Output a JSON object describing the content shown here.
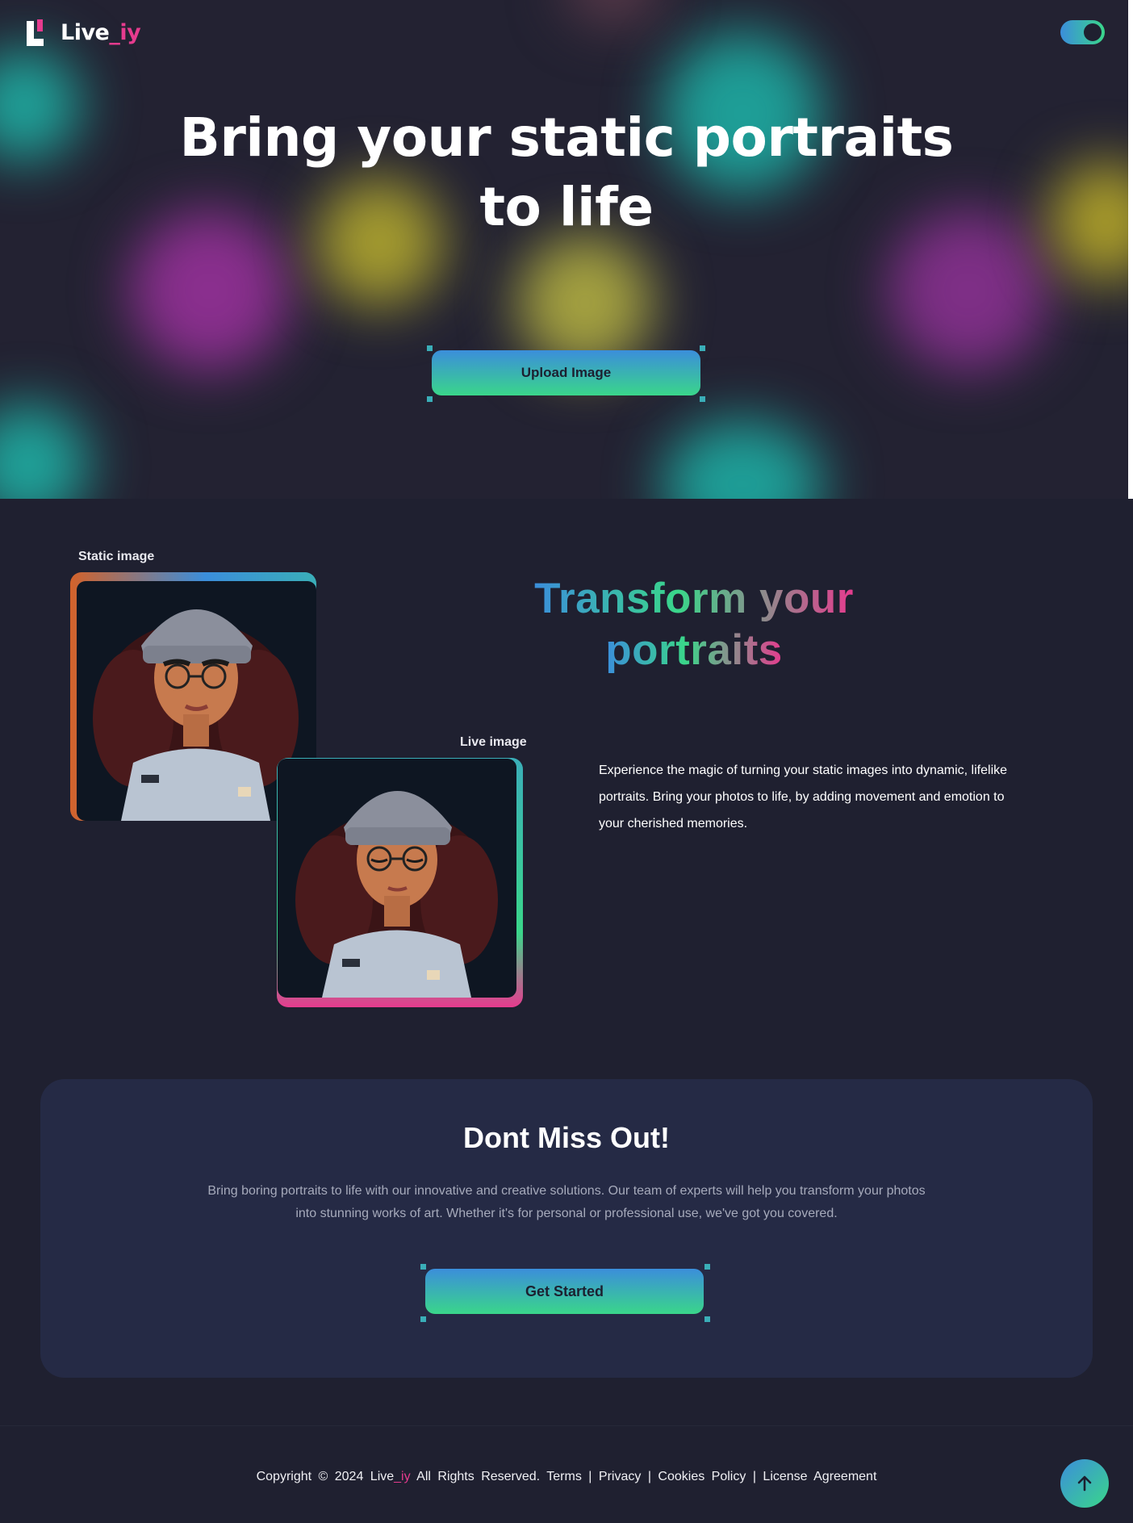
{
  "header": {
    "logo_text": "Live",
    "logo_accent": "_iy",
    "theme_toggle": "on"
  },
  "hero": {
    "title_line1": "Bring your static portraits",
    "title_line2": "to life",
    "upload_label": "Upload Image"
  },
  "transform": {
    "static_label": "Static image",
    "live_label": "Live image",
    "title_line1": "Transform your",
    "title_line2": "portraits",
    "description": "Experience the magic of turning your static images into dynamic, lifelike portraits. Bring your photos to life, by adding movement and emotion to your cherished memories."
  },
  "promo": {
    "title": "Dont Miss Out!",
    "description": "Bring boring portraits to life with our innovative and creative solutions. Our team of experts will help you transform your photos into stunning works of art. Whether it's for personal or professional use, we've got you covered.",
    "cta_label": "Get Started"
  },
  "footer": {
    "copyright_prefix": "Copyright © 2024",
    "brand": "Live",
    "brand_accent": "_iy",
    "rights": "All Rights Reserved.",
    "links": [
      "Terms",
      "Privacy",
      "Cookies Policy",
      "License Agreement"
    ],
    "separator": "|"
  },
  "colors": {
    "background": "#1f2030",
    "accent_pink": "#e63b8e",
    "gradient_blue": "#3b8edb",
    "gradient_green": "#3ad68a",
    "card": "#252a45"
  },
  "icons": [
    "logo-icon",
    "toggle-icon",
    "arrow-up-icon"
  ]
}
